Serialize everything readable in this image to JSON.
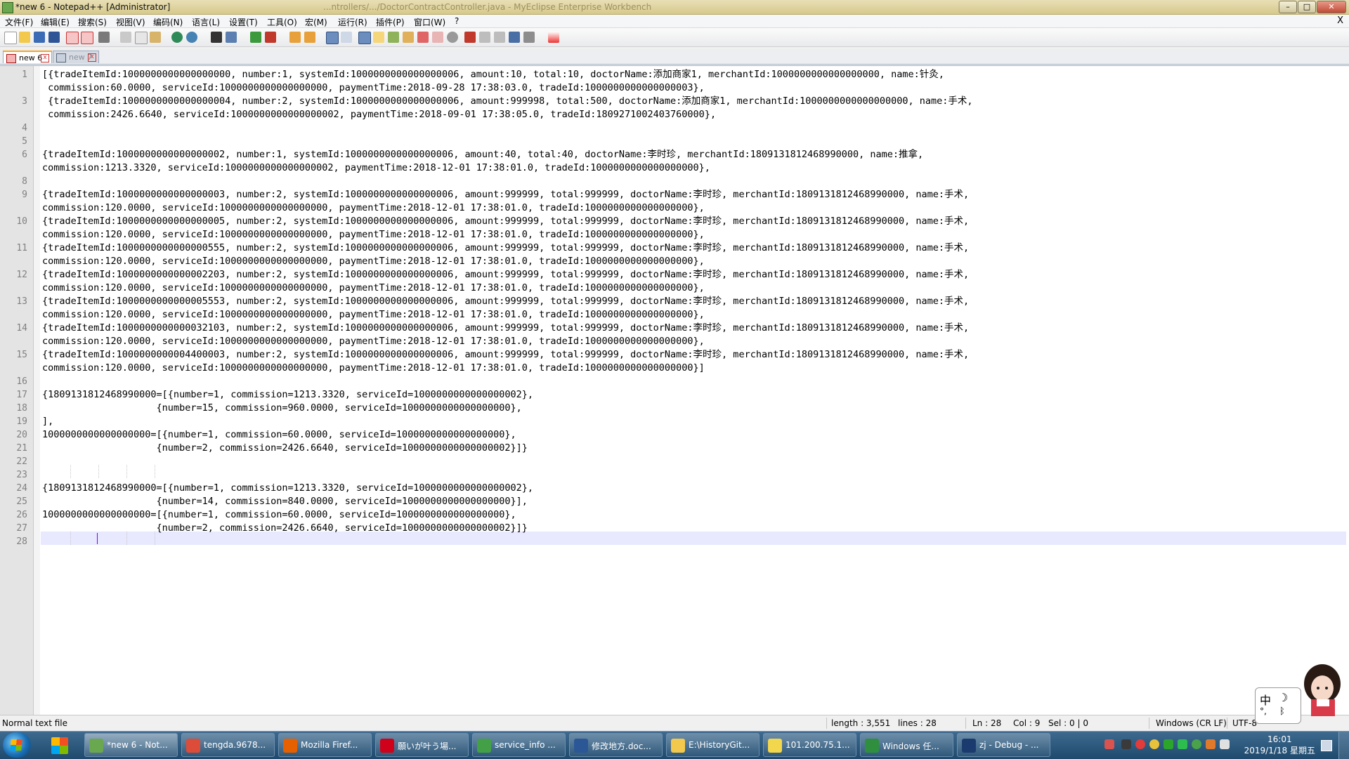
{
  "window": {
    "title": "*new 6 - Notepad++ [Administrator]",
    "background_title": "...ntrollers/.../DoctorContractController.java - MyEclipse Enterprise Workbench",
    "buttons": {
      "minimize": "–",
      "maximize": "□",
      "close": "✕"
    }
  },
  "menu": {
    "items": [
      "文件(F)",
      "编辑(E)",
      "搜索(S)",
      "视图(V)",
      "编码(N)",
      "语言(L)",
      "设置(T)",
      "工具(O)",
      "宏(M)",
      "运行(R)",
      "插件(P)",
      "窗口(W)",
      "?"
    ],
    "close_label": "X"
  },
  "toolbar": {
    "icons": [
      "new-file-icon",
      "open-file-icon",
      "save-icon",
      "save-all-icon",
      "close-icon",
      "close-all-icon",
      "print-icon",
      "cut-icon",
      "copy-icon",
      "paste-icon",
      "undo-icon",
      "redo-icon",
      "find-icon",
      "replace-icon",
      "zoom-in-icon",
      "zoom-out-icon",
      "sync-vertical-icon",
      "sync-horizontal-icon",
      "word-wrap-icon",
      "show-all-chars-icon",
      "indent-guide-icon",
      "user-lang-icon",
      "doc-map-icon",
      "function-list-icon",
      "folder-workspace-icon",
      "monitor-icon",
      "record-macro-icon",
      "stop-record-icon",
      "play-macro-icon",
      "run-macro-multiple-icon",
      "save-macro-icon",
      "spell-check-icon"
    ]
  },
  "tabs": [
    {
      "label": "new 6",
      "active": true
    },
    {
      "label": "new 7",
      "active": false
    }
  ],
  "editor": {
    "lines": [
      {
        "n": "1",
        "text": "[{tradeItemId:1000000000000000000, number:1, systemId:1000000000000000006, amount:10, total:10, doctorName:添加商家1, merchantId:1000000000000000000, name:针灸,"
      },
      {
        "n": "",
        "text": " commission:60.0000, serviceId:1000000000000000000, paymentTime:2018-09-28 17:38:03.0, tradeId:1000000000000000003},"
      },
      {
        "n": "3",
        "text": " {tradeItemId:1000000000000000004, number:2, systemId:1000000000000000006, amount:999998, total:500, doctorName:添加商家1, merchantId:1000000000000000000, name:手术,"
      },
      {
        "n": "",
        "text": " commission:2426.6640, serviceId:1000000000000000002, paymentTime:2018-09-01 17:38:05.0, tradeId:1809271002403760000},"
      },
      {
        "n": "4",
        "text": ""
      },
      {
        "n": "5",
        "text": ""
      },
      {
        "n": "6",
        "text": "{tradeItemId:1000000000000000002, number:1, systemId:1000000000000000006, amount:40, total:40, doctorName:李时珍, merchantId:1809131812468990000, name:推拿,"
      },
      {
        "n": "",
        "text": "commission:1213.3320, serviceId:1000000000000000002, paymentTime:2018-12-01 17:38:01.0, tradeId:1000000000000000000},"
      },
      {
        "n": "8",
        "text": ""
      },
      {
        "n": "9",
        "text": "{tradeItemId:1000000000000000003, number:2, systemId:1000000000000000006, amount:999999, total:999999, doctorName:李时珍, merchantId:1809131812468990000, name:手术,"
      },
      {
        "n": "",
        "text": "commission:120.0000, serviceId:1000000000000000000, paymentTime:2018-12-01 17:38:01.0, tradeId:1000000000000000000},"
      },
      {
        "n": "10",
        "text": "{tradeItemId:1000000000000000005, number:2, systemId:1000000000000000006, amount:999999, total:999999, doctorName:李时珍, merchantId:1809131812468990000, name:手术,"
      },
      {
        "n": "",
        "text": "commission:120.0000, serviceId:1000000000000000000, paymentTime:2018-12-01 17:38:01.0, tradeId:1000000000000000000},"
      },
      {
        "n": "11",
        "text": "{tradeItemId:1000000000000000555, number:2, systemId:1000000000000000006, amount:999999, total:999999, doctorName:李时珍, merchantId:1809131812468990000, name:手术,"
      },
      {
        "n": "",
        "text": "commission:120.0000, serviceId:1000000000000000000, paymentTime:2018-12-01 17:38:01.0, tradeId:1000000000000000000},"
      },
      {
        "n": "12",
        "text": "{tradeItemId:1000000000000002203, number:2, systemId:1000000000000000006, amount:999999, total:999999, doctorName:李时珍, merchantId:1809131812468990000, name:手术,"
      },
      {
        "n": "",
        "text": "commission:120.0000, serviceId:1000000000000000000, paymentTime:2018-12-01 17:38:01.0, tradeId:1000000000000000000},"
      },
      {
        "n": "13",
        "text": "{tradeItemId:1000000000000005553, number:2, systemId:1000000000000000006, amount:999999, total:999999, doctorName:李时珍, merchantId:1809131812468990000, name:手术,"
      },
      {
        "n": "",
        "text": "commission:120.0000, serviceId:1000000000000000000, paymentTime:2018-12-01 17:38:01.0, tradeId:1000000000000000000},"
      },
      {
        "n": "14",
        "text": "{tradeItemId:1000000000000032103, number:2, systemId:1000000000000000006, amount:999999, total:999999, doctorName:李时珍, merchantId:1809131812468990000, name:手术,"
      },
      {
        "n": "",
        "text": "commission:120.0000, serviceId:1000000000000000000, paymentTime:2018-12-01 17:38:01.0, tradeId:1000000000000000000},"
      },
      {
        "n": "15",
        "text": "{tradeItemId:1000000000004400003, number:2, systemId:1000000000000000006, amount:999999, total:999999, doctorName:李时珍, merchantId:1809131812468990000, name:手术,"
      },
      {
        "n": "",
        "text": "commission:120.0000, serviceId:1000000000000000000, paymentTime:2018-12-01 17:38:01.0, tradeId:1000000000000000000}]"
      },
      {
        "n": "16",
        "text": ""
      },
      {
        "n": "17",
        "text": "{1809131812468990000=[{number=1, commission=1213.3320, serviceId=1000000000000000002},"
      },
      {
        "n": "18",
        "text": "                    {number=15, commission=960.0000, serviceId=1000000000000000000},"
      },
      {
        "n": "19",
        "text": "],"
      },
      {
        "n": "20",
        "text": "1000000000000000000=[{number=1, commission=60.0000, serviceId=1000000000000000000},"
      },
      {
        "n": "21",
        "text": "                    {number=2, commission=2426.6640, serviceId=1000000000000000002}]}"
      },
      {
        "n": "22",
        "text": ""
      },
      {
        "n": "23",
        "text": ""
      },
      {
        "n": "24",
        "text": "{1809131812468990000=[{number=1, commission=1213.3320, serviceId=1000000000000000002},"
      },
      {
        "n": "25",
        "text": "                    {number=14, commission=840.0000, serviceId=1000000000000000000}],"
      },
      {
        "n": "26",
        "text": "1000000000000000000=[{number=1, commission=60.0000, serviceId=1000000000000000000},"
      },
      {
        "n": "27",
        "text": "                    {number=2, commission=2426.6640, serviceId=1000000000000000002}]}"
      },
      {
        "n": "28",
        "text": ""
      }
    ]
  },
  "status": {
    "file_type": "Normal text file",
    "length": "length : 3,551",
    "lines": "lines : 28",
    "ln": "Ln : 28",
    "col": "Col : 9",
    "sel": "Sel : 0 | 0",
    "eol": "Windows (CR LF)",
    "encoding": "UTF-8"
  },
  "taskbar": {
    "tasks": [
      {
        "label": "*new 6 - Not...",
        "icon": "notepadpp-icon",
        "color": "#6aa84f",
        "active": true
      },
      {
        "label": "tengda.9678...",
        "icon": "chrome-icon",
        "color": "#dd4b39",
        "active": false
      },
      {
        "label": "Mozilla Firef...",
        "icon": "firefox-icon",
        "color": "#e66000",
        "active": false
      },
      {
        "label": "願いが叶う場...",
        "icon": "netease-music-icon",
        "color": "#d0021b",
        "active": false
      },
      {
        "label": "service_info ...",
        "icon": "navicat-icon",
        "color": "#43a047",
        "active": false
      },
      {
        "label": "修改地方.doc...",
        "icon": "word-icon",
        "color": "#2b5797",
        "active": false
      },
      {
        "label": "E:\\HistoryGit...",
        "icon": "folder-icon",
        "color": "#f2c94c",
        "active": false
      },
      {
        "label": "101.200.75.1...",
        "icon": "remote-desktop-icon",
        "color": "#f2d64b",
        "active": false
      },
      {
        "label": "Windows 任...",
        "icon": "task-manager-icon",
        "color": "#2f8f3f",
        "active": false
      },
      {
        "label": "zj - Debug - ...",
        "icon": "myeclipse-icon",
        "color": "#1b3b6f",
        "active": false
      }
    ],
    "ime_chars": {
      "zh": "中",
      "moon": "☽",
      "dots": "°,",
      "bf": "ᛒ"
    },
    "clock_time": "16:01",
    "clock_date": "2019/1/18 星期五"
  }
}
